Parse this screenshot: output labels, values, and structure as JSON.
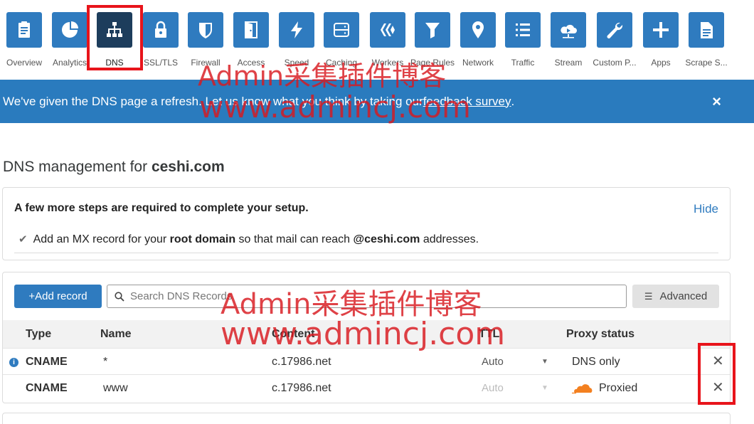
{
  "nav": [
    {
      "label": "Overview",
      "icon": "clipboard-icon"
    },
    {
      "label": "Analytics",
      "icon": "pie-chart-icon"
    },
    {
      "label": "DNS",
      "icon": "sitemap-icon"
    },
    {
      "label": "SSL/TLS",
      "icon": "lock-icon"
    },
    {
      "label": "Firewall",
      "icon": "shield-icon"
    },
    {
      "label": "Access",
      "icon": "door-icon"
    },
    {
      "label": "Speed",
      "icon": "bolt-icon"
    },
    {
      "label": "Caching",
      "icon": "server-icon"
    },
    {
      "label": "Workers",
      "icon": "workers-icon"
    },
    {
      "label": "Page Rules",
      "icon": "filter-icon"
    },
    {
      "label": "Network",
      "icon": "location-pin-icon"
    },
    {
      "label": "Traffic",
      "icon": "list-icon"
    },
    {
      "label": "Stream",
      "icon": "cloud-play-icon"
    },
    {
      "label": "Custom P...",
      "icon": "wrench-icon"
    },
    {
      "label": "Apps",
      "icon": "plus-icon"
    },
    {
      "label": "Scrape S...",
      "icon": "document-icon"
    }
  ],
  "banner": {
    "text_before": "We've given the DNS page a refresh. Let us know what you think by taking our ",
    "link": "feedback survey",
    "text_after": ".",
    "close": "×"
  },
  "page": {
    "title_prefix": "DNS management for ",
    "domain": "ceshi.com"
  },
  "setup": {
    "heading": "A few more steps are required to complete your setup.",
    "hide": "Hide",
    "step_part1": "Add an MX record for your ",
    "step_bold1": "root domain",
    "step_part2": " so that mail can reach ",
    "step_bold2": "@ceshi.com",
    "step_part3": " addresses."
  },
  "records": {
    "add_label": "+Add record",
    "search_placeholder": "Search DNS Records",
    "advanced_label": "Advanced",
    "columns": {
      "type": "Type",
      "name": "Name",
      "content": "Content",
      "ttl": "TTL",
      "proxy": "Proxy status"
    },
    "rows": [
      {
        "type": "CNAME",
        "name": "*",
        "content": "c.17986.net",
        "ttl": "Auto",
        "proxy": "DNS only"
      },
      {
        "type": "CNAME",
        "name": "www",
        "content": "c.17986.net",
        "ttl": "Auto",
        "proxy": "Proxied"
      }
    ]
  },
  "watermark": {
    "line1": "Admin采集插件博客",
    "line2": "www.admincj.com"
  },
  "colors": {
    "accent": "#2f7bbf",
    "active_tile": "#1d3d5c",
    "highlight": "#e8141b",
    "cloud": "#f38020"
  }
}
